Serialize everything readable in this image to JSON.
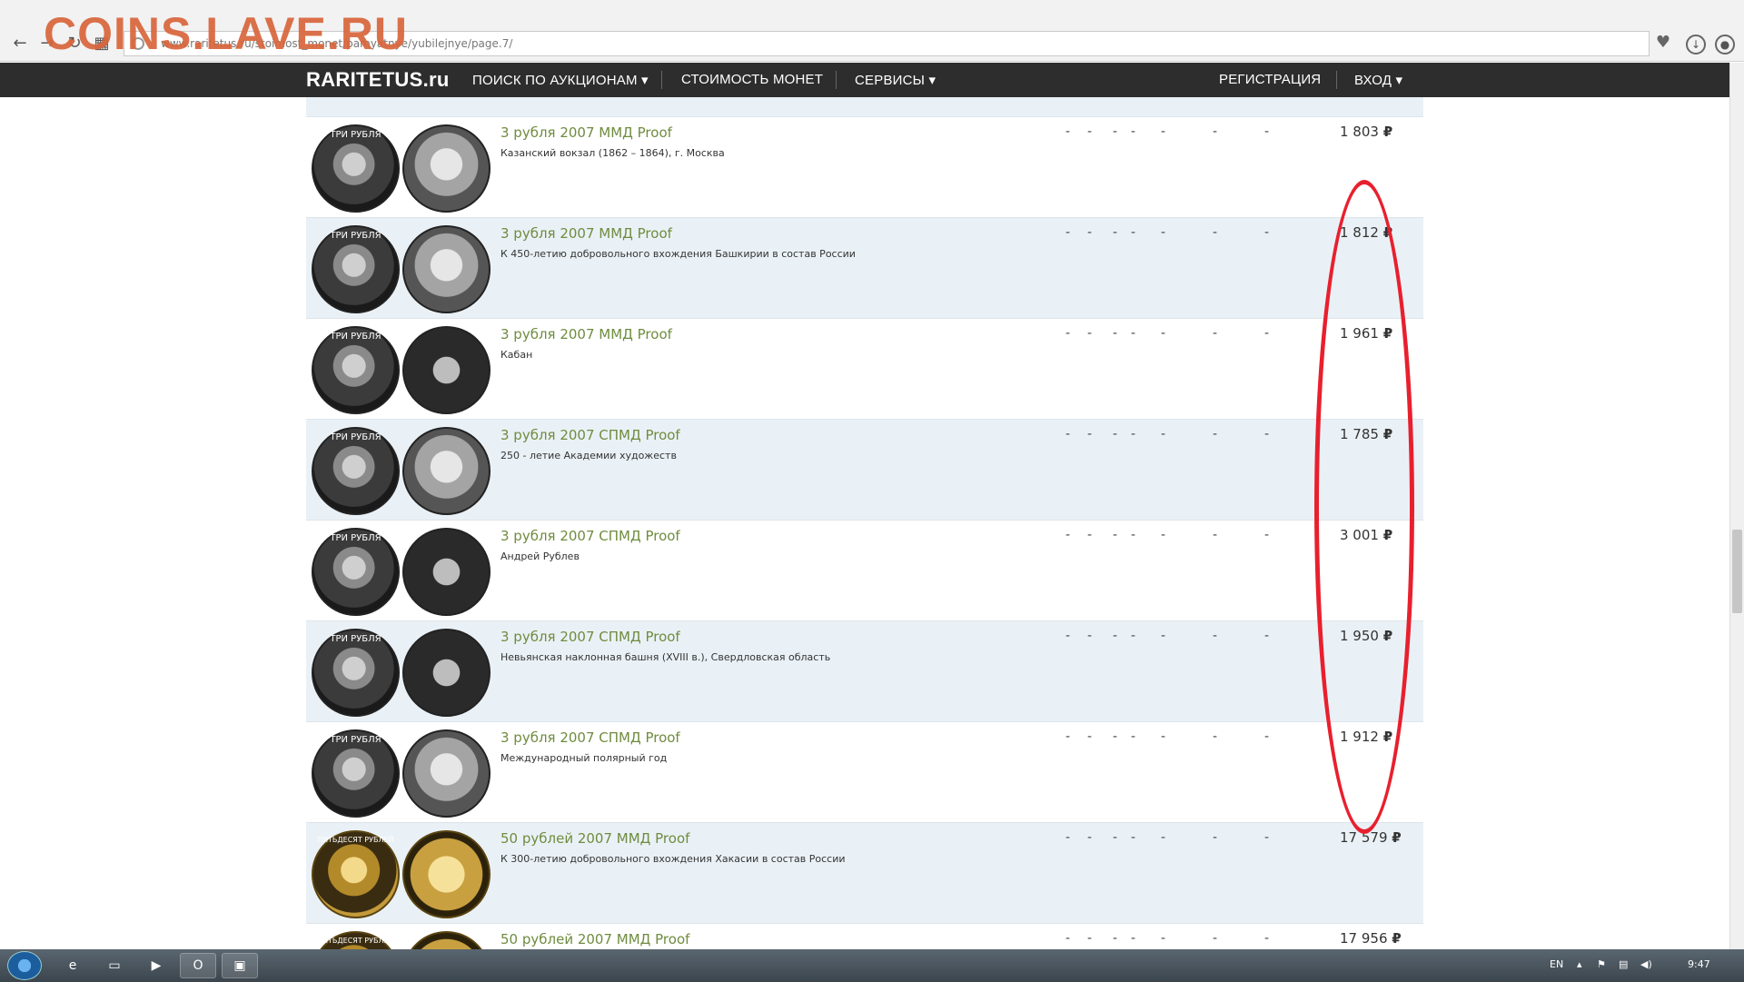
{
  "watermark": "COINS.LAVE.RU",
  "browser": {
    "url": "www.raritetus.ru/stoimost_monet/pamyatnye/yubilejnye/page.7/"
  },
  "site_nav": {
    "logo": "RARITETUS.ru",
    "items": [
      "ПОИСК ПО АУКЦИОНАМ",
      "СТОИМОСТЬ МОНЕТ",
      "СЕРВИСЫ"
    ],
    "register": "РЕГИСТРАЦИЯ",
    "login": "ВХОД"
  },
  "coins": [
    {
      "title": "3 рубля 2007 ММД Proof",
      "desc": "Казанский вокзал (1862 – 1864), г. Москва",
      "price": "1 803",
      "obv": "ТРИ РУБЛЯ",
      "metal": "silver"
    },
    {
      "title": "3 рубля 2007 ММД Proof",
      "desc": "К 450-летию добровольного вхождения Башкирии в состав России",
      "price": "1 812",
      "obv": "ТРИ РУБЛЯ",
      "metal": "silver"
    },
    {
      "title": "3 рубля 2007 ММД Proof",
      "desc": "Кабан",
      "price": "1 961",
      "obv": "ТРИ РУБЛЯ",
      "metal": "silver"
    },
    {
      "title": "3 рубля 2007 СПМД Proof",
      "desc": "250 - летие Академии художеств",
      "price": "1 785",
      "obv": "ТРИ РУБЛЯ",
      "metal": "silver"
    },
    {
      "title": "3 рубля 2007 СПМД Proof",
      "desc": "Андрей Рублев",
      "price": "3 001",
      "obv": "ТРИ РУБЛЯ",
      "metal": "silver"
    },
    {
      "title": "3 рубля 2007 СПМД Proof",
      "desc": "Невьянская наклонная башня (XVIII в.), Свердловская область",
      "price": "1 950",
      "obv": "ТРИ РУБЛЯ",
      "metal": "silver"
    },
    {
      "title": "3 рубля 2007 СПМД Proof",
      "desc": "Международный полярный год",
      "price": "1 912",
      "obv": "ТРИ РУБЛЯ",
      "metal": "silver"
    },
    {
      "title": "50 рублей 2007 ММД Proof",
      "desc": "К 300-летию добровольного вхождения Хакасии в состав России",
      "price": "17 579",
      "obv": "ПЯТЬДЕСЯТ РУБЛЕЙ",
      "metal": "gold"
    },
    {
      "title": "50 рублей 2007 ММД Proof",
      "desc": "",
      "price": "17 956",
      "obv": "ПЯТЬДЕСЯТ РУБЛЕЙ",
      "metal": "gold"
    }
  ],
  "currency_symbol": "₽",
  "dash": "-",
  "taskbar": {
    "lang": "EN",
    "time": "9:47"
  },
  "colors": {
    "nav_bg": "#2d2d2d",
    "title_green": "#6f8c3e",
    "row_alt": "#eaf1f6",
    "annotation_red": "#e8202e",
    "watermark": "#d9653b"
  }
}
